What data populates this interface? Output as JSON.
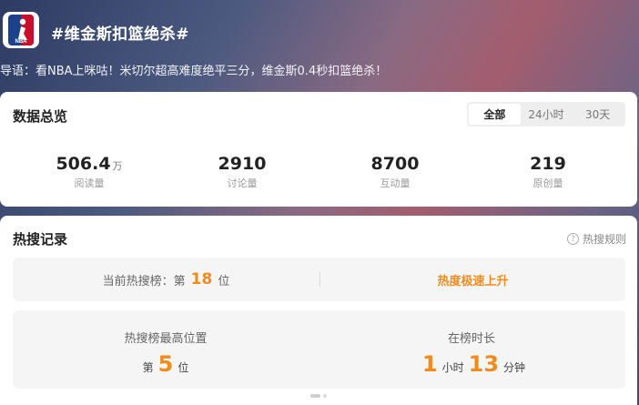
{
  "header": {
    "logo_text": "NBA",
    "title": "#维金斯扣篮绝杀#",
    "intro": "导语：看NBA上咪咕！米切尔超高难度绝平三分，维金斯0.4秒扣篮绝杀！"
  },
  "overview": {
    "title": "数据总览",
    "tabs": [
      "全部",
      "24小时",
      "30天"
    ],
    "active_tab": "全部",
    "stats": [
      {
        "value": "506.4",
        "unit": "万",
        "label": "阅读量"
      },
      {
        "value": "2910",
        "unit": "",
        "label": "讨论量"
      },
      {
        "value": "8700",
        "unit": "",
        "label": "互动量"
      },
      {
        "value": "219",
        "unit": "",
        "label": "原创量"
      }
    ]
  },
  "hot_search": {
    "title": "热搜记录",
    "rules_link": "热搜规则",
    "current_rank": {
      "prefix": "当前热搜榜：第",
      "value": "18",
      "suffix": "位"
    },
    "trend": "热度极速上升",
    "highest": {
      "label": "热搜榜最高位置",
      "prefix": "第",
      "value": "5",
      "suffix": "位"
    },
    "duration": {
      "label": "在榜时长",
      "hours": "1",
      "hours_unit": "小时",
      "minutes": "13",
      "minutes_unit": "分钟"
    }
  },
  "colors": {
    "accent": "#f08c1e",
    "nba_blue": "#1d428a",
    "nba_red": "#c8102e"
  },
  "icons": {
    "logo": "nba-logo-icon",
    "help": "question-circle-icon"
  }
}
